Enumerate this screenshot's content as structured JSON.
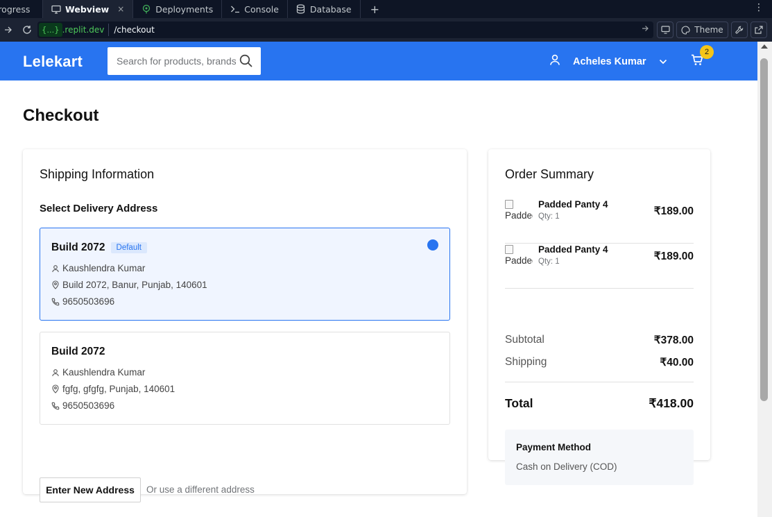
{
  "ide": {
    "tabs": [
      {
        "label": "Progress"
      },
      {
        "label": "Webview",
        "active": true
      },
      {
        "label": "Deployments"
      },
      {
        "label": "Console"
      },
      {
        "label": "Database"
      }
    ],
    "tab_close": "×",
    "add_tab": "+",
    "more": "⋮",
    "url_domain_chip": "{...}",
    "url_domain_rest": ".replit.dev",
    "url_path": "/checkout",
    "theme_label": "Theme"
  },
  "site": {
    "logo": "Lelekart",
    "search_placeholder": "Search for products, brands and more",
    "user_name": "Acheles Kumar",
    "cart_count": "2",
    "brand_color": "#2874f0"
  },
  "page": {
    "title": "Checkout"
  },
  "shipping": {
    "heading": "Shipping Information",
    "subheading": "Select Delivery Address",
    "addresses": [
      {
        "title": "Build 2072",
        "tag": "Default",
        "name": "Kaushlendra Kumar",
        "address": "Build 2072, Banur, Punjab, 140601",
        "phone": "9650503696",
        "selected": true
      },
      {
        "title": "Build 2072",
        "name": "Kaushlendra Kumar",
        "address": "fgfg, gfgfg, Punjab, 140601",
        "phone": "9650503696",
        "selected": false
      }
    ],
    "new_address_button": "Enter New Address",
    "new_address_hint": "Or use a different address"
  },
  "summary": {
    "heading": "Order Summary",
    "items": [
      {
        "img_alt": "Padded",
        "name": "Padded Panty 4",
        "qty": "Qty: 1",
        "price": "₹189.00"
      },
      {
        "img_alt": "Padded",
        "name": "Padded Panty 4",
        "qty": "Qty: 1",
        "price": "₹189.00"
      }
    ],
    "subtotal_label": "Subtotal",
    "subtotal_value": "₹378.00",
    "shipping_label": "Shipping",
    "shipping_value": "₹40.00",
    "total_label": "Total",
    "total_value": "₹418.00",
    "payment_label": "Payment Method",
    "payment_value": "Cash on Delivery (COD)"
  }
}
